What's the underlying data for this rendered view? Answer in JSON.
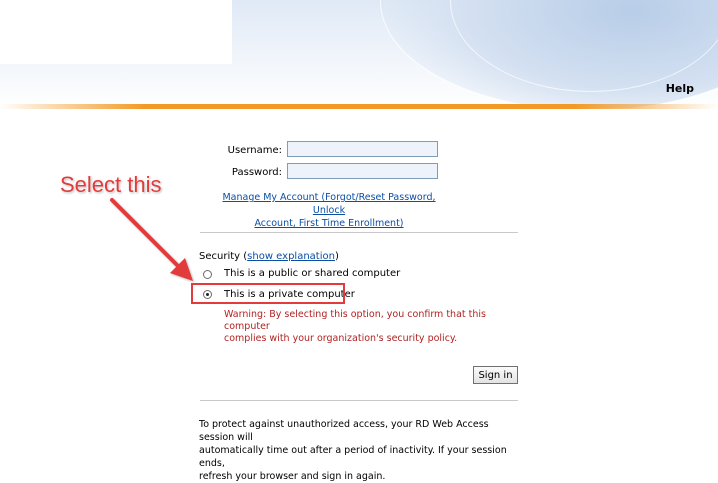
{
  "header": {
    "help_label": "Help"
  },
  "form": {
    "username_label": "Username:",
    "username_value": "",
    "password_label": "Password:",
    "password_value": "",
    "manage_account_line1": "Manage My Account (Forgot/Reset Password, Unlock",
    "manage_account_line2": "Account, First Time Enrollment)"
  },
  "security": {
    "label_prefix": "Security (",
    "explanation_link": "show explanation",
    "label_suffix": ")",
    "options": [
      {
        "label": "This is a public or shared computer",
        "selected": false
      },
      {
        "label": "This is a private computer",
        "selected": true
      }
    ],
    "warning_line1": "Warning: By selecting this option, you confirm that this computer",
    "warning_line2": "complies with your organization's security policy."
  },
  "signin_label": "Sign in",
  "notice": {
    "line1": "To protect against unauthorized access, your RD Web Access session will",
    "line2": "automatically time out after a period of inactivity. If your session ends,",
    "line3": "refresh your browser and sign in again."
  },
  "annotation": {
    "callout_text": "Select this",
    "color": "#e23b3b"
  },
  "colors": {
    "accent_orange": "#f39a26",
    "link_blue": "#0b4fa5",
    "warning_red": "#b22222"
  }
}
